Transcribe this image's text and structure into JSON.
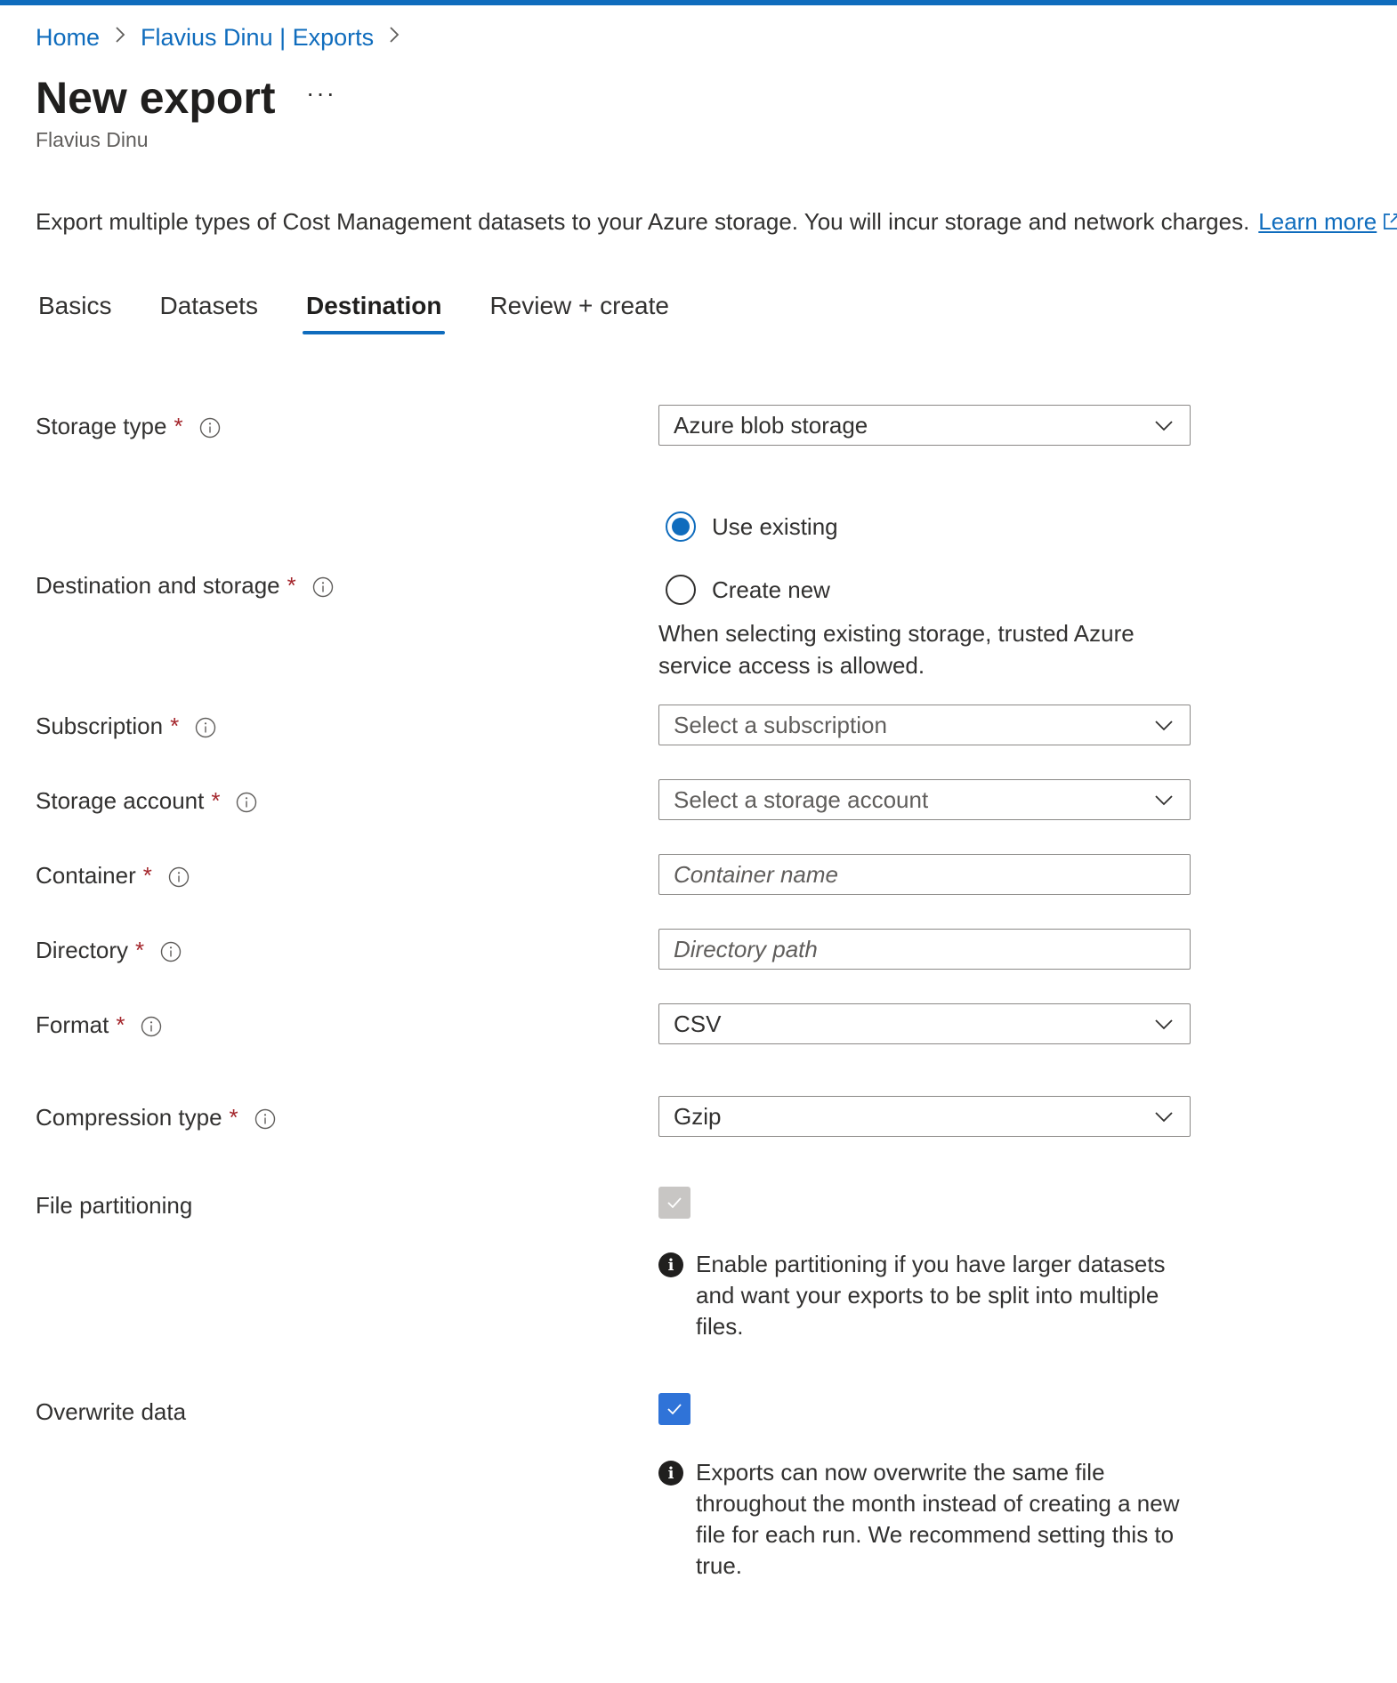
{
  "breadcrumb": {
    "items": [
      "Home",
      "Flavius Dinu | Exports"
    ]
  },
  "header": {
    "title": "New export",
    "more_label": "···",
    "subtitle": "Flavius Dinu"
  },
  "intro": {
    "text": "Export multiple types of Cost Management datasets to your Azure storage. You will incur storage and network charges.",
    "link": "Learn more"
  },
  "tabs": [
    {
      "label": "Basics",
      "active": false
    },
    {
      "label": "Datasets",
      "active": false
    },
    {
      "label": "Destination",
      "active": true
    },
    {
      "label": "Review + create",
      "active": false
    }
  ],
  "form": {
    "required_marker": "*",
    "storage_type": {
      "label": "Storage type",
      "value": "Azure blob storage"
    },
    "destination": {
      "label": "Destination and storage",
      "options": [
        "Use existing",
        "Create new"
      ],
      "selected": "Use existing",
      "note": "When selecting existing storage, trusted Azure service access is allowed."
    },
    "subscription": {
      "label": "Subscription",
      "placeholder": "Select a subscription"
    },
    "storage_account": {
      "label": "Storage account",
      "placeholder": "Select a storage account"
    },
    "container": {
      "label": "Container",
      "placeholder": "Container name"
    },
    "directory": {
      "label": "Directory",
      "placeholder": "Directory path"
    },
    "format": {
      "label": "Format",
      "value": "CSV"
    },
    "compression": {
      "label": "Compression type",
      "value": "Gzip"
    },
    "file_partitioning": {
      "label": "File partitioning",
      "checked": true,
      "disabled": true,
      "note": "Enable partitioning if you have larger datasets and want your exports to be split into multiple files."
    },
    "overwrite": {
      "label": "Overwrite data",
      "checked": true,
      "note": "Exports can now overwrite the same file throughout the month instead of creating a new file for each run. We recommend setting this to true."
    }
  },
  "icons": {
    "info": "info-icon",
    "chevron": "chevron-down-icon",
    "external": "external-link-icon",
    "check": "checkmark-icon",
    "breadcrumb_separator": "chevron-right-icon"
  },
  "colors": {
    "accent": "#0f6cbd",
    "required": "#a4262c",
    "checkbox_checked": "#2f73d8",
    "checkbox_disabled": "#c8c6c4"
  }
}
